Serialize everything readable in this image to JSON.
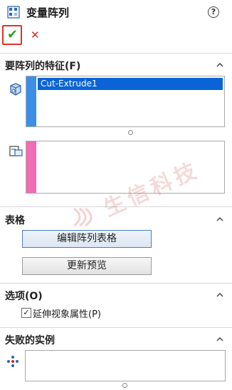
{
  "header": {
    "title": "变量阵列",
    "help_symbol": "?"
  },
  "actions": {
    "ok_symbol": "✔",
    "cancel_symbol": "✕"
  },
  "sections": {
    "features": {
      "title": "要阵列的特征(F)",
      "items": [
        "Cut-Extrude1"
      ],
      "stripe_color": "#3d8ee6"
    },
    "references": {
      "items": [],
      "stripe_color": "#f06cb5"
    },
    "table": {
      "title": "表格",
      "edit_button": "编辑阵列表格",
      "preview_button": "更新预览"
    },
    "options": {
      "title": "选项(O)",
      "propagate_label": "延伸视象属性(P)",
      "propagate_checked": true
    },
    "failed": {
      "title": "失败的实例",
      "items": []
    }
  },
  "watermark": {
    "text": "生信科技"
  }
}
